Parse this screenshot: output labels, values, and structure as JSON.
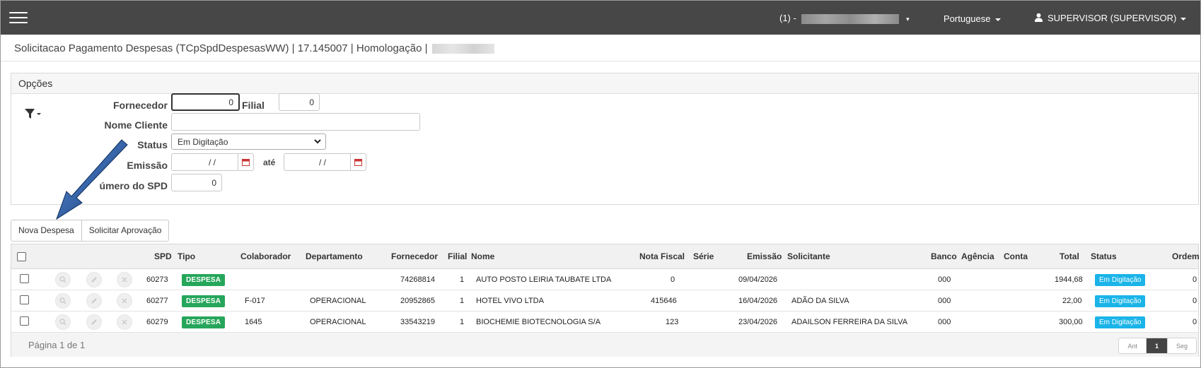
{
  "topbar": {
    "user_id_prefix": "(1) -",
    "language": "Portuguese",
    "user": "SUPERVISOR (SUPERVISOR)"
  },
  "page": {
    "title": "Solicitacao Pagamento Despesas (TCpSpdDespesasWW) | 17.145007 | Homologação |"
  },
  "options": {
    "header": "Opções",
    "fornecedor_label": "Fornecedor",
    "fornecedor_value": "0",
    "filial_label": "Filial",
    "filial_value": "0",
    "nome_cliente_label": "Nome Cliente",
    "nome_cliente_value": "",
    "status_label": "Status",
    "status_value": "Em Digitação",
    "emissao_label": "Emissão",
    "emissao_from": "/ /",
    "ate_label": "até",
    "emissao_to": "/ /",
    "numero_spd_label": "úmero do SPD",
    "numero_spd_value": "0"
  },
  "actions": {
    "nova_despesa": "Nova Despesa",
    "solicitar_aprovacao": "Solicitar Aprovação"
  },
  "grid": {
    "columns": {
      "spd": "SPD",
      "tipo": "Tipo",
      "colaborador": "Colaborador",
      "departamento": "Departamento",
      "fornecedor": "Fornecedor",
      "filial": "Filial",
      "nome": "Nome",
      "nota_fiscal": "Nota Fiscal",
      "serie": "Série",
      "emissao": "Emissão",
      "solicitante": "Solicitante",
      "banco": "Banco",
      "agencia": "Agência",
      "conta": "Conta",
      "total": "Total",
      "status": "Status",
      "ordem": "Ordem"
    },
    "rows": [
      {
        "spd": "60273",
        "tipo": "DESPESA",
        "colaborador": "",
        "departamento": "",
        "fornecedor": "74268814",
        "filial": "1",
        "nome": "AUTO POSTO LEIRIA TAUBATE LTDA",
        "nota_fiscal": "0",
        "serie": "",
        "emissao": "09/04/2026",
        "solicitante": "",
        "banco": "000",
        "agencia": "",
        "conta": "",
        "total": "1944,68",
        "status": "Em Digitação",
        "ordem": "0"
      },
      {
        "spd": "60277",
        "tipo": "DESPESA",
        "colaborador": "F-017",
        "departamento": "OPERACIONAL",
        "fornecedor": "20952865",
        "filial": "1",
        "nome": "HOTEL VIVO LTDA",
        "nota_fiscal": "415646",
        "serie": "",
        "emissao": "16/04/2026",
        "solicitante": "ADÃO DA SILVA",
        "banco": "000",
        "agencia": "",
        "conta": "",
        "total": "22,00",
        "status": "Em Digitação",
        "ordem": "0"
      },
      {
        "spd": "60279",
        "tipo": "DESPESA",
        "colaborador": "1645",
        "departamento": "OPERACIONAL",
        "fornecedor": "33543219",
        "filial": "1",
        "nome": "BIOCHEMIE BIOTECNOLOGIA S/A",
        "nota_fiscal": "123",
        "serie": "",
        "emissao": "23/04/2026",
        "solicitante": "ADAILSON FERREIRA DA SILVA",
        "banco": "000",
        "agencia": "",
        "conta": "",
        "total": "300,00",
        "status": "Em Digitação",
        "ordem": "0"
      }
    ],
    "page_info": "Página 1 de 1",
    "pager": {
      "prev": "Ant",
      "current": "1",
      "next": "Seg"
    }
  },
  "colors": {
    "topbar": "#474747",
    "despesa_badge": "#26a65b",
    "status_badge": "#1ab4e8",
    "annotation_arrow": "#1f4e8c"
  }
}
